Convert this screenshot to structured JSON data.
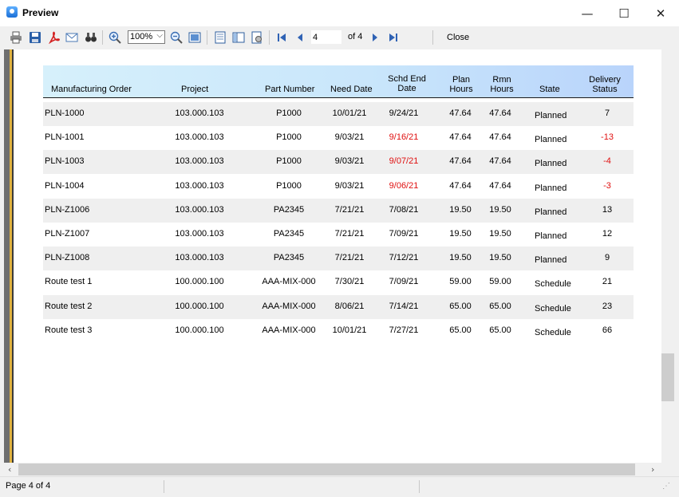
{
  "window": {
    "title": "Preview",
    "minimize_glyph": "—",
    "maximize_glyph": "☐",
    "close_glyph": "✕"
  },
  "toolbar": {
    "icons": [
      "print-icon",
      "save-icon",
      "pdf-icon",
      "email-icon",
      "find-icon",
      "zoom-in-icon",
      "zoom-out-icon",
      "fit-page-icon",
      "one-page-icon",
      "two-page-icon",
      "page-setup-icon",
      "first-page-icon",
      "prev-page-icon",
      "next-page-icon",
      "last-page-icon"
    ],
    "zoom": "100%",
    "page_value": "4",
    "of_label": "of 4",
    "close_label": "Close"
  },
  "report": {
    "headers": {
      "manufacturing_order": "Manufacturing Order",
      "project": "Project",
      "part_number": "Part Number",
      "need_date": "Need Date",
      "schd_end_date_1": "Schd End",
      "schd_end_date_2": "Date",
      "plan_hours_1": "Plan",
      "plan_hours_2": "Hours",
      "rmn_hours_1": "Rmn",
      "rmn_hours_2": "Hours",
      "state": "State",
      "delivery_status_1": "Delivery",
      "delivery_status_2": "Status"
    },
    "rows": [
      {
        "mo": "PLN-1000",
        "project": "103.000.103",
        "part": "P1000",
        "need": "10/01/21",
        "schd": "9/24/21",
        "plan": "47.64",
        "rmn": "47.64",
        "state": "Planned",
        "status": "7",
        "late": false
      },
      {
        "mo": "PLN-1001",
        "project": "103.000.103",
        "part": "P1000",
        "need": "9/03/21",
        "schd": "9/16/21",
        "plan": "47.64",
        "rmn": "47.64",
        "state": "Planned",
        "status": "-13",
        "late": true
      },
      {
        "mo": "PLN-1003",
        "project": "103.000.103",
        "part": "P1000",
        "need": "9/03/21",
        "schd": "9/07/21",
        "plan": "47.64",
        "rmn": "47.64",
        "state": "Planned",
        "status": "-4",
        "late": true
      },
      {
        "mo": "PLN-1004",
        "project": "103.000.103",
        "part": "P1000",
        "need": "9/03/21",
        "schd": "9/06/21",
        "plan": "47.64",
        "rmn": "47.64",
        "state": "Planned",
        "status": "-3",
        "late": true
      },
      {
        "mo": "PLN-Z1006",
        "project": "103.000.103",
        "part": "PA2345",
        "need": "7/21/21",
        "schd": "7/08/21",
        "plan": "19.50",
        "rmn": "19.50",
        "state": "Planned",
        "status": "13",
        "late": false
      },
      {
        "mo": "PLN-Z1007",
        "project": "103.000.103",
        "part": "PA2345",
        "need": "7/21/21",
        "schd": "7/09/21",
        "plan": "19.50",
        "rmn": "19.50",
        "state": "Planned",
        "status": "12",
        "late": false
      },
      {
        "mo": "PLN-Z1008",
        "project": "103.000.103",
        "part": "PA2345",
        "need": "7/21/21",
        "schd": "7/12/21",
        "plan": "19.50",
        "rmn": "19.50",
        "state": "Planned",
        "status": "9",
        "late": false
      },
      {
        "mo": "Route test 1",
        "project": "100.000.100",
        "part": "AAA-MIX-000",
        "need": "7/30/21",
        "schd": "7/09/21",
        "plan": "59.00",
        "rmn": "59.00",
        "state": "Schedule",
        "status": "21",
        "late": false
      },
      {
        "mo": "Route test 2",
        "project": "100.000.100",
        "part": "AAA-MIX-000",
        "need": "8/06/21",
        "schd": "7/14/21",
        "plan": "65.00",
        "rmn": "65.00",
        "state": "Schedule",
        "status": "23",
        "late": false
      },
      {
        "mo": "Route test 3",
        "project": "100.000.100",
        "part": "AAA-MIX-000",
        "need": "10/01/21",
        "schd": "7/27/21",
        "plan": "65.00",
        "rmn": "65.00",
        "state": "Schedule",
        "status": "66",
        "late": false
      }
    ]
  },
  "statusbar": {
    "page_text": "Page 4 of 4"
  },
  "colors": {
    "late": "#e01010",
    "header_start": "#d6f0fb",
    "header_end": "#b9d4fb",
    "row_shade": "#efefef"
  }
}
